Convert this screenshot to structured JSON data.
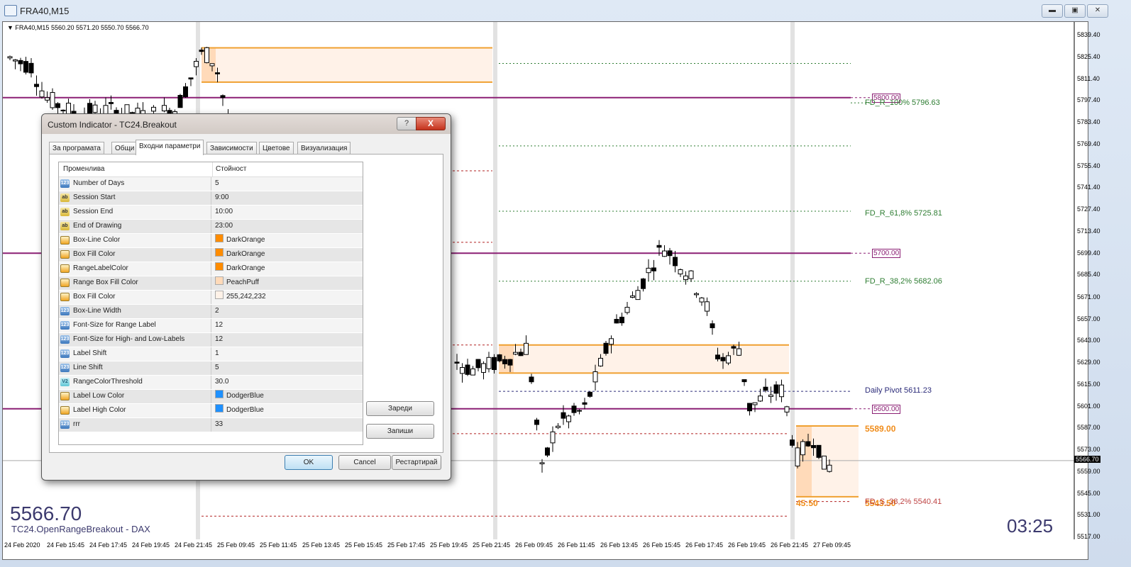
{
  "window": {
    "title": "FRA40,M15",
    "controls": {
      "minimize": "minimize-icon",
      "maximize": "maximize-icon",
      "close": "close-icon"
    }
  },
  "chart": {
    "info_line": "FRA40,M15  5560.20 5571.20 5550.70 5566.70",
    "big_price": "5566.70",
    "indicator_name": "TC24.OpenRangeBreakout - DAX",
    "countdown": "03:25",
    "current_price_label": "5566.70",
    "colors": {
      "range_box_line": "#f0a030",
      "range_box_fill": "#fff2e8",
      "range_box_session_fill": "#ffdab9",
      "round_level": "#8b1f74",
      "fib_label": "#2e7d32",
      "pivot_label": "#2c2c7a",
      "range_label": "#f08c1a",
      "s_label": "#b22222"
    },
    "price_levels": {
      "round_labels": [
        "5800.00",
        "5700.00",
        "5600.00"
      ],
      "fib_labels": [
        {
          "text": "FD_R_100%  5796.63",
          "price": 5796.63
        },
        {
          "text": "FD_R_61,8%  5725.81",
          "price": 5725.81
        },
        {
          "text": "FD_R_38,2%  5682.06",
          "price": 5682.06
        }
      ],
      "pivot_label": {
        "text": "Daily Pivot  5611.23",
        "price": 5611.23
      },
      "range_high_label": "5589.00",
      "range_size_label": "45:50",
      "range_low_label_overlap": "5543.50",
      "s_label": {
        "text": "FD_S_38,2%  5540.41",
        "price": 5540.41
      }
    }
  },
  "chart_data": {
    "type": "candlestick",
    "title": "FRA40,M15",
    "ylim": [
      5517.0,
      5845.0
    ],
    "y_ticks": [
      "5839.40",
      "5825.40",
      "5811.40",
      "5797.40",
      "5783.40",
      "5769.40",
      "5755.40",
      "5741.40",
      "5727.40",
      "5713.40",
      "5699.40",
      "5685.40",
      "5671.00",
      "5657.00",
      "5643.00",
      "5629.00",
      "5615.00",
      "5601.00",
      "5587.00",
      "5573.00",
      "5559.00",
      "5545.00",
      "5531.00",
      "5517.00"
    ],
    "x_ticks": [
      "24 Feb 2020",
      "24 Feb 15:45",
      "24 Feb 17:45",
      "24 Feb 19:45",
      "24 Feb 21:45",
      "25 Feb 09:45",
      "25 Feb 11:45",
      "25 Feb 13:45",
      "25 Feb 15:45",
      "25 Feb 17:45",
      "25 Feb 19:45",
      "25 Feb 21:45",
      "26 Feb 09:45",
      "26 Feb 11:45",
      "26 Feb 13:45",
      "26 Feb 15:45",
      "26 Feb 17:45",
      "26 Feb 19:45",
      "26 Feb 21:45",
      "27 Feb 09:45"
    ],
    "last_ohlc": {
      "open": 5560.2,
      "high": 5571.2,
      "low": 5550.7,
      "close": 5566.7
    },
    "horizontal_levels": [
      5800.0,
      5700.0,
      5600.0,
      5796.63,
      5725.81,
      5682.06,
      5611.23,
      5540.41
    ],
    "range_boxes": [
      {
        "day": "25 Feb",
        "high": 5832.0,
        "low": 5810.0
      },
      {
        "day": "26 Feb",
        "high": 5641.0,
        "low": 5623.0
      },
      {
        "day": "27 Feb",
        "high": 5589.0,
        "low": 5543.5
      }
    ]
  },
  "dialog": {
    "title": "Custom Indicator - TC24.Breakout",
    "help_label": "?",
    "close_label": "X",
    "tabs": [
      {
        "label": "За програмата",
        "active": false
      },
      {
        "label": "Общи",
        "active": false
      },
      {
        "label": "Входни параметри",
        "active": true
      },
      {
        "label": "Зависимости",
        "active": false
      },
      {
        "label": "Цветове",
        "active": false
      },
      {
        "label": "Визуализация",
        "active": false
      }
    ],
    "grid_headers": {
      "name": "Променлива",
      "value": "Стойност"
    },
    "params": [
      {
        "type": "int",
        "icon": "123",
        "name": "Number of Days",
        "value": "5"
      },
      {
        "type": "str",
        "icon": "ab",
        "name": "Session Start",
        "value": "9:00"
      },
      {
        "type": "str",
        "icon": "ab",
        "name": "Session End",
        "value": "10:00"
      },
      {
        "type": "str",
        "icon": "ab",
        "name": "End of Drawing",
        "value": "23:00"
      },
      {
        "type": "color",
        "icon": "",
        "name": "Box-Line Color",
        "value": "DarkOrange",
        "swatch": "#ff8c00"
      },
      {
        "type": "color",
        "icon": "",
        "name": "Box Fill Color",
        "value": "DarkOrange",
        "swatch": "#ff8c00"
      },
      {
        "type": "color",
        "icon": "",
        "name": "RangeLabelColor",
        "value": "DarkOrange",
        "swatch": "#ff8c00"
      },
      {
        "type": "color",
        "icon": "",
        "name": "Range Box Fill Color",
        "value": "PeachPuff",
        "swatch": "#ffdab9"
      },
      {
        "type": "color",
        "icon": "",
        "name": "Box Fill Color",
        "value": "255,242,232",
        "swatch": "#fff2e8"
      },
      {
        "type": "int",
        "icon": "123",
        "name": "Box-Line Width",
        "value": "2"
      },
      {
        "type": "int",
        "icon": "123",
        "name": "Font-Size for Range Label",
        "value": "12"
      },
      {
        "type": "int",
        "icon": "123",
        "name": "Font-Size for High- and Low-Labels",
        "value": "12"
      },
      {
        "type": "int",
        "icon": "123",
        "name": "Label Shift",
        "value": "1"
      },
      {
        "type": "int",
        "icon": "123",
        "name": "Line Shift",
        "value": "5"
      },
      {
        "type": "dbl",
        "icon": "V2",
        "name": "RangeColorThreshold",
        "value": "30.0"
      },
      {
        "type": "color",
        "icon": "",
        "name": "Label Low Color",
        "value": "DodgerBlue",
        "swatch": "#1e90ff"
      },
      {
        "type": "color",
        "icon": "",
        "name": "Label High Color",
        "value": "DodgerBlue",
        "swatch": "#1e90ff"
      },
      {
        "type": "int",
        "icon": "123",
        "name": "rrr",
        "value": "33"
      }
    ],
    "load_label": "Зареди",
    "save_label": "Запиши",
    "ok_label": "OK",
    "cancel_label": "Cancel",
    "reset_label": "Рестартирай"
  }
}
